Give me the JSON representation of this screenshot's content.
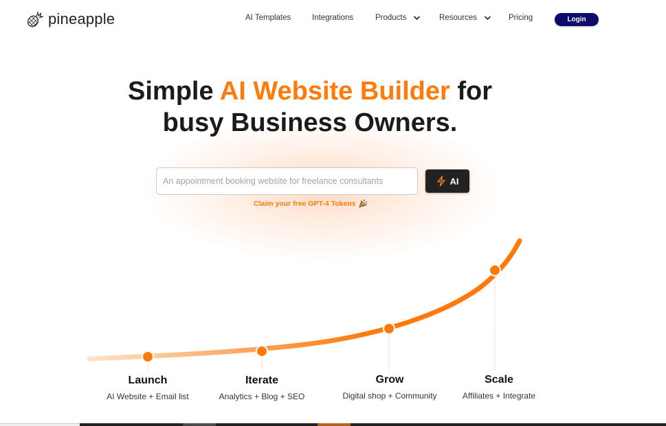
{
  "brand": {
    "name": "pineapple",
    "logo_icon": "pineapple-icon"
  },
  "nav": {
    "items": [
      {
        "label": "AI Templates",
        "has_dropdown": false
      },
      {
        "label": "Integrations",
        "has_dropdown": false
      },
      {
        "label": "Products",
        "has_dropdown": true
      },
      {
        "label": "Resources",
        "has_dropdown": true
      },
      {
        "label": "Pricing",
        "has_dropdown": false
      }
    ],
    "login_label": "Login"
  },
  "hero": {
    "headline_prefix": "Simple ",
    "headline_accent": "AI Website Builder",
    "headline_suffix": " for",
    "headline_line2": "busy Business Owners.",
    "prompt_placeholder": "An appointment booking website for freelance consultants",
    "prompt_value": "",
    "ai_button_label": "AI",
    "ai_button_icon": "lightning-bolt-icon",
    "claim_text": "Claim your free GPT-4 Tokens",
    "claim_icon": "party-popper-icon"
  },
  "growth_path": {
    "stages": [
      {
        "title": "Launch",
        "desc": "AI Website + Email list"
      },
      {
        "title": "Iterate",
        "desc": "Analytics + Blog + SEO"
      },
      {
        "title": "Grow",
        "desc": "Digital shop + Community"
      },
      {
        "title": "Scale",
        "desc": "Affiliates + Integrate"
      }
    ]
  },
  "colors": {
    "accent": "#ff7a0a",
    "login_bg": "#0d0a6b",
    "ai_button_bg": "#222222",
    "text": "#1b1b1b"
  }
}
